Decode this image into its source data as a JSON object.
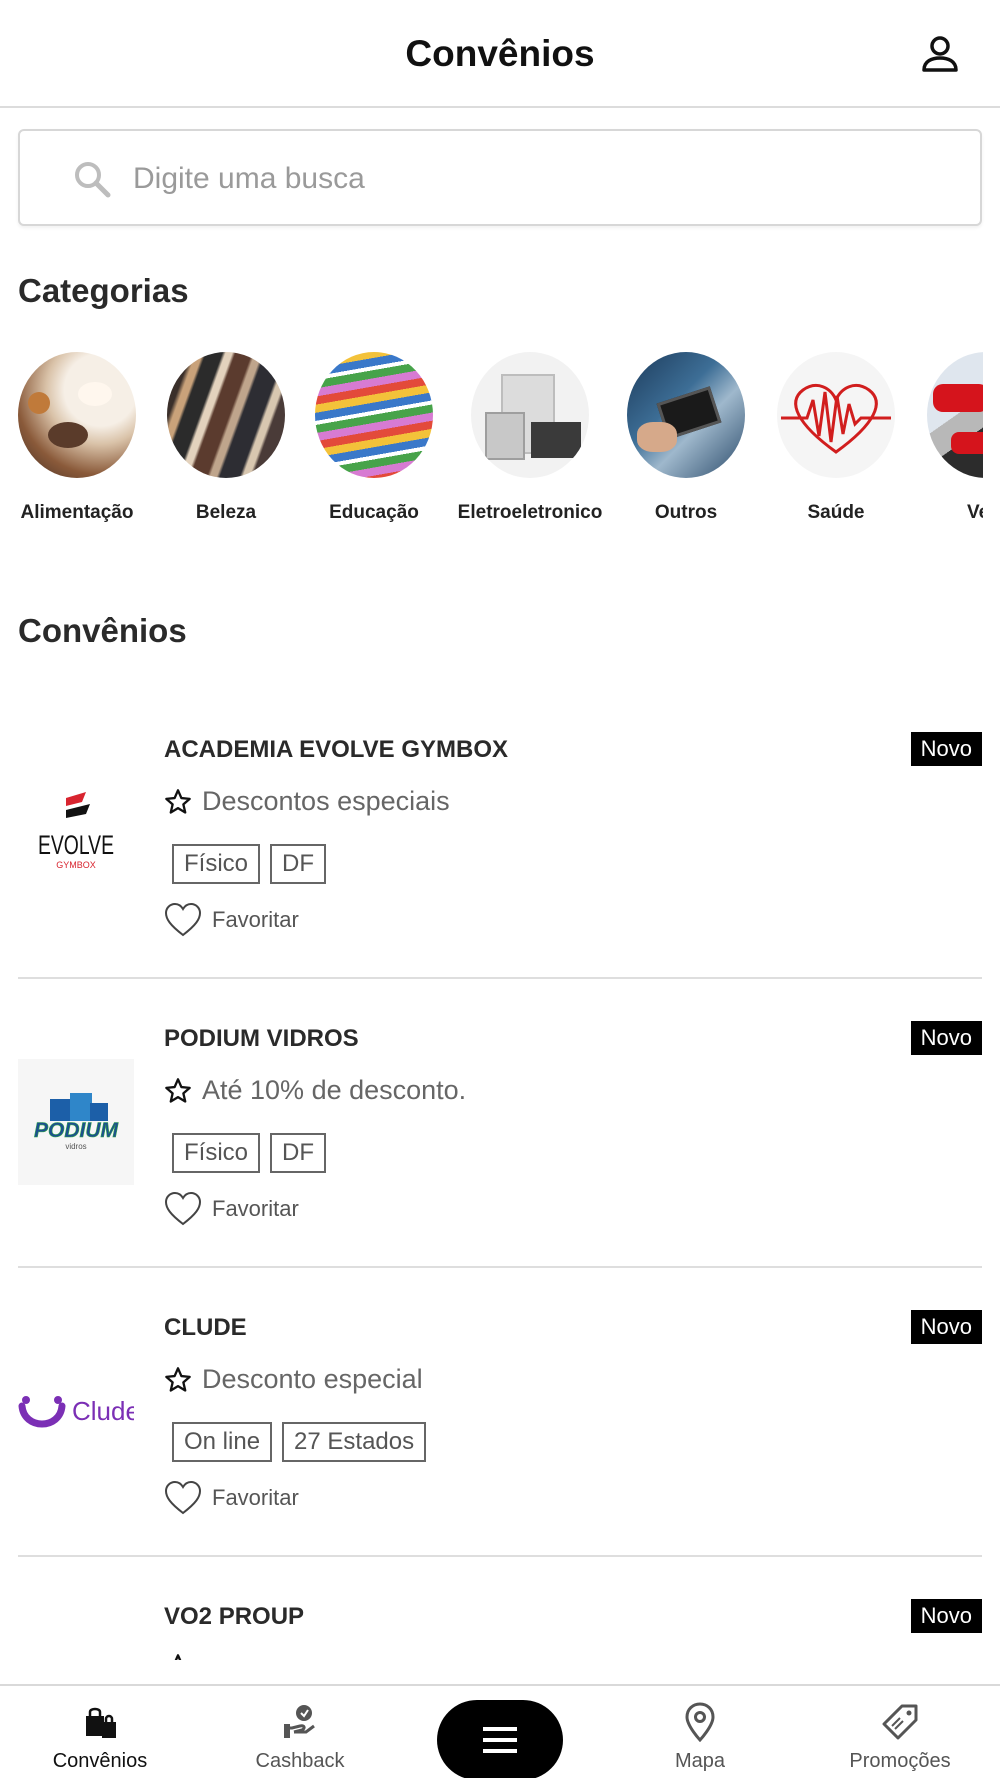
{
  "header": {
    "title": "Convênios",
    "profile_icon": "person-icon"
  },
  "search": {
    "placeholder": "Digite uma busca",
    "value": ""
  },
  "categories": {
    "title": "Categorias",
    "items": [
      {
        "label": "Alimentação",
        "icon": "food-photo"
      },
      {
        "label": "Beleza",
        "icon": "makeup-brushes-photo"
      },
      {
        "label": "Educação",
        "icon": "notebooks-photo"
      },
      {
        "label": "Eletroeletronico",
        "icon": "appliances-photo"
      },
      {
        "label": "Outros",
        "icon": "tablet-photo"
      },
      {
        "label": "Saúde",
        "icon": "heartbeat-photo"
      },
      {
        "label": "Veíc",
        "icon": "cars-photo"
      }
    ]
  },
  "convenios": {
    "title": "Convênios",
    "items": [
      {
        "name": "ACADEMIA EVOLVE GYMBOX",
        "badge": "Novo",
        "discount": "Descontos especiais",
        "tags": [
          "Físico",
          "DF"
        ],
        "favorite_label": "Favoritar",
        "logo_main": "EVOLVE",
        "logo_sub": "GYMBOX"
      },
      {
        "name": "PODIUM VIDROS",
        "badge": "Novo",
        "discount": "Até 10% de desconto.",
        "tags": [
          "Físico",
          "DF"
        ],
        "favorite_label": "Favoritar",
        "logo_main": "PODIUM",
        "logo_sub": "vidros"
      },
      {
        "name": "CLUDE",
        "badge": "Novo",
        "discount": "Desconto especial",
        "tags": [
          "On line",
          "27 Estados"
        ],
        "favorite_label": "Favoritar",
        "logo_main": "Clude"
      },
      {
        "name": "VO2 PROUP",
        "badge": "Novo"
      }
    ]
  },
  "bottom_nav": {
    "items": [
      {
        "label": "Convênios",
        "icon": "shopping-bags-icon",
        "active": true
      },
      {
        "label": "Cashback",
        "icon": "cashback-hand-icon",
        "active": false
      },
      {
        "label": "",
        "icon": "menu-icon",
        "active": false
      },
      {
        "label": "Mapa",
        "icon": "map-pin-icon",
        "active": false
      },
      {
        "label": "Promoções",
        "icon": "price-tag-icon",
        "active": false
      }
    ]
  },
  "colors": {
    "badge_bg": "#000000",
    "clude_purple": "#7b2fb5",
    "evolve_red": "#d8242f",
    "podium_blue": "#1c5fa8",
    "podium_green": "#2fa24a"
  }
}
